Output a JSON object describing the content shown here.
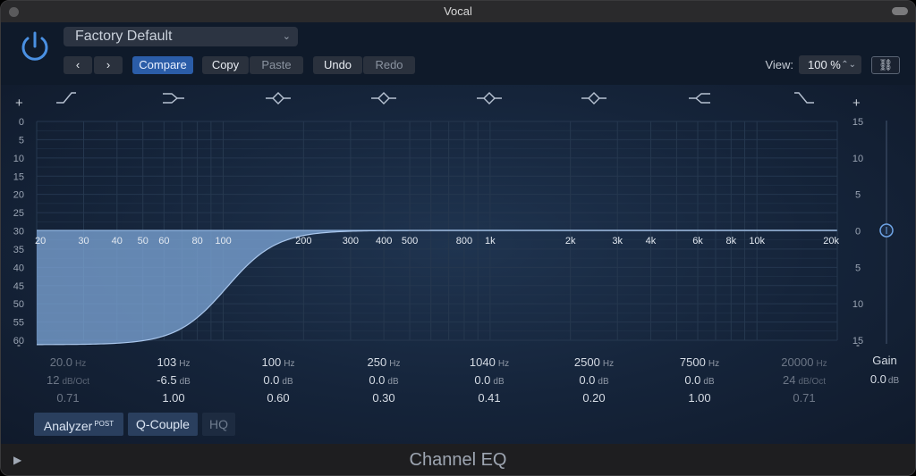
{
  "window": {
    "title": "Vocal"
  },
  "header": {
    "preset": "Factory Default",
    "compare_label": "Compare",
    "copy_label": "Copy",
    "paste_label": "Paste",
    "undo_label": "Undo",
    "redo_label": "Redo",
    "view_label": "View:",
    "view_value": "100 %"
  },
  "graph": {
    "plus_left": "+",
    "plus_right": "+",
    "minus_left": "-",
    "minus_right": "-",
    "db_left": [
      "0",
      "5",
      "10",
      "15",
      "20",
      "25",
      "30",
      "35",
      "40",
      "45",
      "50",
      "55",
      "60"
    ],
    "db_right": [
      "15",
      "10",
      "5",
      "0",
      "5",
      "10",
      "15"
    ],
    "freq_labels": [
      "20",
      "30",
      "40",
      "50",
      "60",
      "80",
      "100",
      "200",
      "300",
      "400",
      "500",
      "800",
      "1k",
      "2k",
      "3k",
      "4k",
      "6k",
      "8k",
      "10k",
      "20k"
    ],
    "band_icons": [
      "lowcut-icon",
      "lowshelf-icon",
      "peak-icon",
      "peak-icon",
      "peak-icon",
      "peak-icon",
      "highshelf-icon",
      "highcut-icon"
    ]
  },
  "bands": [
    {
      "freq": "20.0",
      "freq_unit": "Hz",
      "gain": "12",
      "gain_unit": "dB/Oct",
      "q": "0.71",
      "enabled": false
    },
    {
      "freq": "103",
      "freq_unit": "Hz",
      "gain": "-6.5",
      "gain_unit": "dB",
      "q": "1.00",
      "enabled": true
    },
    {
      "freq": "100",
      "freq_unit": "Hz",
      "gain": "0.0",
      "gain_unit": "dB",
      "q": "0.60",
      "enabled": true
    },
    {
      "freq": "250",
      "freq_unit": "Hz",
      "gain": "0.0",
      "gain_unit": "dB",
      "q": "0.30",
      "enabled": true
    },
    {
      "freq": "1040",
      "freq_unit": "Hz",
      "gain": "0.0",
      "gain_unit": "dB",
      "q": "0.41",
      "enabled": true
    },
    {
      "freq": "2500",
      "freq_unit": "Hz",
      "gain": "0.0",
      "gain_unit": "dB",
      "q": "0.20",
      "enabled": true
    },
    {
      "freq": "7500",
      "freq_unit": "Hz",
      "gain": "0.0",
      "gain_unit": "dB",
      "q": "1.00",
      "enabled": true
    },
    {
      "freq": "20000",
      "freq_unit": "Hz",
      "gain": "24",
      "gain_unit": "dB/Oct",
      "q": "0.71",
      "enabled": false
    }
  ],
  "gain": {
    "label": "Gain",
    "value": "0.0",
    "unit": "dB"
  },
  "bottom": {
    "analyzer_label": "Analyzer",
    "analyzer_sup": "POST",
    "qcouple_label": "Q-Couple",
    "hq_label": "HQ"
  },
  "footer": {
    "title": "Channel EQ"
  },
  "colors": {
    "accent": "#4a90e2",
    "curve_fill": "#7fa8da",
    "panel_bg": "#15243a"
  }
}
